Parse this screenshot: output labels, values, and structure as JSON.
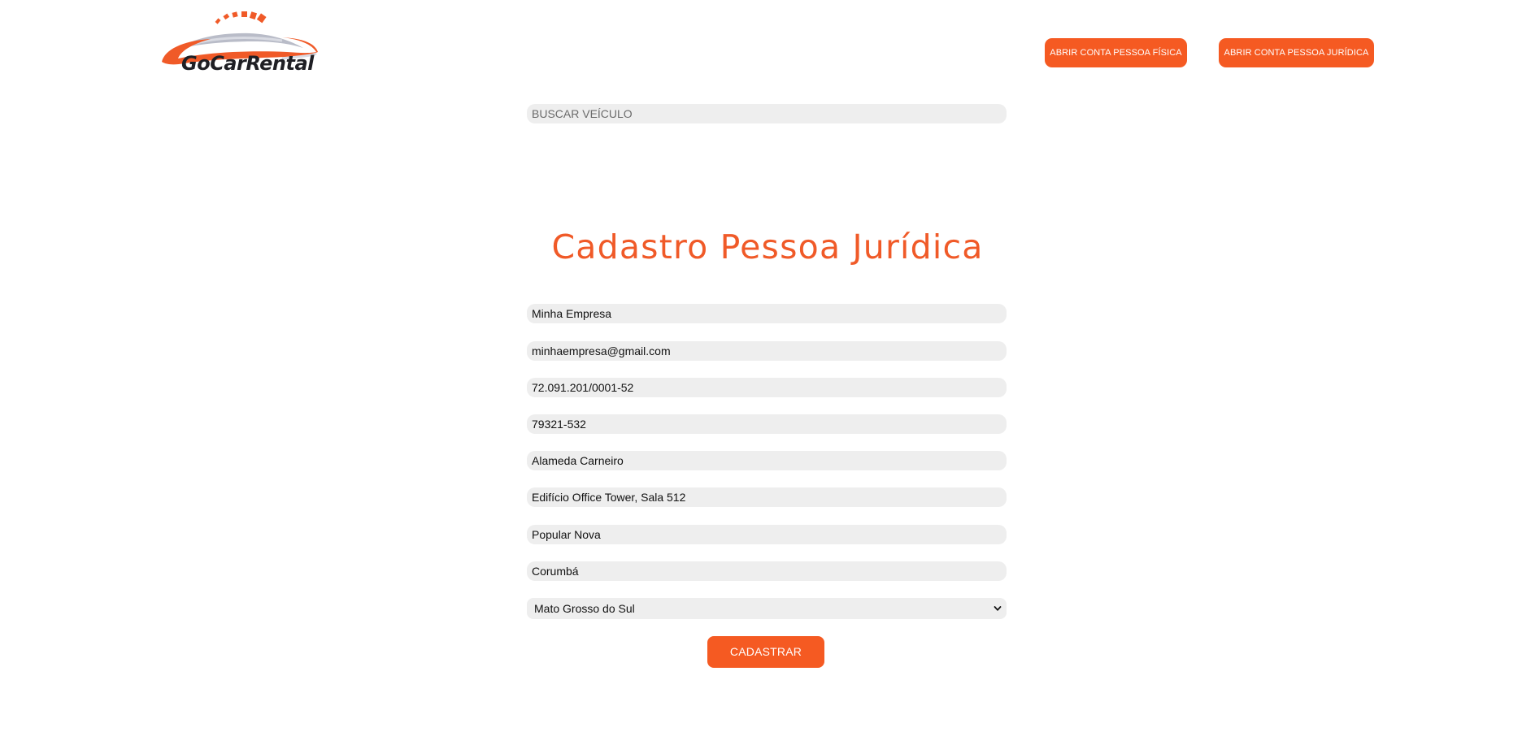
{
  "header": {
    "logo_text": "GoCarRental",
    "btn_pessoa_fisica": "ABRIR CONTA PESSOA FÍSICA",
    "btn_pessoa_juridica": "ABRIR CONTA PESSOA JURÍDICA"
  },
  "search": {
    "placeholder": "BUSCAR VEÍCULO"
  },
  "form": {
    "title": "Cadastro Pessoa Jurídica",
    "fields": [
      "Minha Empresa",
      "minhaempresa@gmail.com",
      "72.091.201/0001-52",
      "79321-532",
      "Alameda Carneiro",
      "Edifício Office Tower, Sala 512",
      "Popular Nova",
      "Corumbá"
    ],
    "state_select": "Mato Grosso do Sul",
    "submit_label": "CADASTRAR"
  },
  "colors": {
    "accent": "#f55a22",
    "field_bg": "#eeeeee",
    "title": "#f05a28"
  }
}
